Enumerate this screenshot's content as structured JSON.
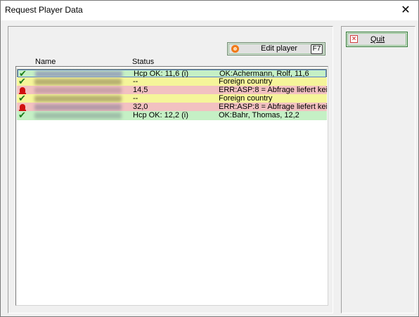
{
  "window": {
    "title": "Request Player Data",
    "close_label": "✕"
  },
  "toolbar": {
    "edit_label": "Edit player",
    "edit_key": "F7",
    "quit_label": "Quit"
  },
  "columns": {
    "name": "Name",
    "status": "Status"
  },
  "rows": [
    {
      "type": "ok",
      "name_color": "#9aa8ba",
      "status": "Hcp OK: 11,6 (i)",
      "result": "OK:Achermann, Rolf, 11,6"
    },
    {
      "type": "warn",
      "name_color": "#b7b070",
      "status": "--",
      "result": "Foreign country"
    },
    {
      "type": "err",
      "name_color": "#c9a0a8",
      "status": "14,5",
      "result": "ERR:ASP:8 = Abfrage liefert keir"
    },
    {
      "type": "warn",
      "name_color": "#b7b070",
      "status": "--",
      "result": "Foreign country"
    },
    {
      "type": "err",
      "name_color": "#b59aa8",
      "status": "32,0",
      "result": "ERR:ASP:8 = Abfrage liefert keir"
    },
    {
      "type": "ok",
      "name_color": "#9fc0a8",
      "status": "Hcp OK: 12,2 (i)",
      "result": "OK:Bahr, Thomas, 12,2"
    }
  ],
  "icons": {
    "ok": "checkmark-icon",
    "warn": "checkmark-icon",
    "err": "alarm-bell-icon",
    "edit": "edit-target-icon",
    "quit": "close-box-icon"
  },
  "colors": {
    "ok_row": "#c5f0c5",
    "warn_row": "#f5f59a",
    "err_row": "#f2c1c1"
  }
}
